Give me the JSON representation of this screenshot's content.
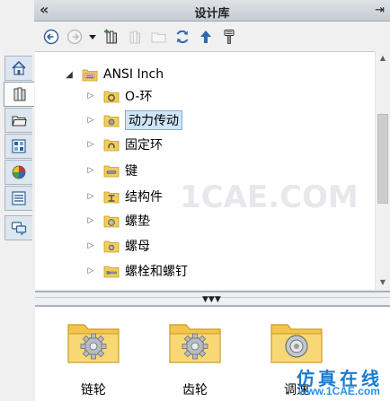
{
  "panel": {
    "title": "设计库",
    "collapse_glyph": "«",
    "pin_glyph": "⇥"
  },
  "tabs": [
    {
      "name": "home-icon",
      "active": false
    },
    {
      "name": "design-library-icon",
      "active": true
    },
    {
      "name": "file-explorer-icon",
      "active": false
    },
    {
      "name": "view-palette-icon",
      "active": false
    },
    {
      "name": "appearances-icon",
      "active": false
    },
    {
      "name": "custom-properties-icon",
      "active": false
    },
    {
      "name": "forum-icon",
      "active": false
    }
  ],
  "toolbar": [
    {
      "name": "back-icon"
    },
    {
      "name": "forward-icon"
    },
    {
      "name": "dropdown-icon"
    },
    {
      "name": "add-to-library-icon"
    },
    {
      "name": "delete-icon"
    },
    {
      "name": "new-folder-icon"
    },
    {
      "name": "refresh-icon"
    },
    {
      "name": "up-folder-icon"
    },
    {
      "name": "options-icon"
    }
  ],
  "tree": {
    "root": {
      "label": "ANSI Inch",
      "expanded": true
    },
    "items": [
      {
        "label": "O-环",
        "selected": false,
        "icon": "o-ring-folder-icon"
      },
      {
        "label": "动力传动",
        "selected": true,
        "icon": "power-transmission-folder-icon"
      },
      {
        "label": "固定环",
        "selected": false,
        "icon": "retaining-ring-folder-icon"
      },
      {
        "label": "键",
        "selected": false,
        "icon": "key-folder-icon"
      },
      {
        "label": "结构件",
        "selected": false,
        "icon": "structural-folder-icon"
      },
      {
        "label": "螺垫",
        "selected": false,
        "icon": "washer-folder-icon"
      },
      {
        "label": "螺母",
        "selected": false,
        "icon": "nut-folder-icon"
      },
      {
        "label": "螺栓和螺钉",
        "selected": false,
        "icon": "bolt-folder-icon"
      }
    ]
  },
  "gallery": {
    "items": [
      {
        "label": "链轮",
        "icon": "gear-folder-icon"
      },
      {
        "label": "齿轮",
        "icon": "gear-folder-icon"
      },
      {
        "label": "调速",
        "icon": "disc-folder-icon"
      }
    ]
  },
  "watermark": {
    "center_text": "1CAE.COM",
    "brand_cn": "仿真在线",
    "brand_site": "www.1CAE.com"
  },
  "colors": {
    "selection_bg": "#cde5f7",
    "selection_border": "#7daed8",
    "folder_yellow": "#f3cc5a",
    "brand_blue": "#1a7bd1"
  }
}
